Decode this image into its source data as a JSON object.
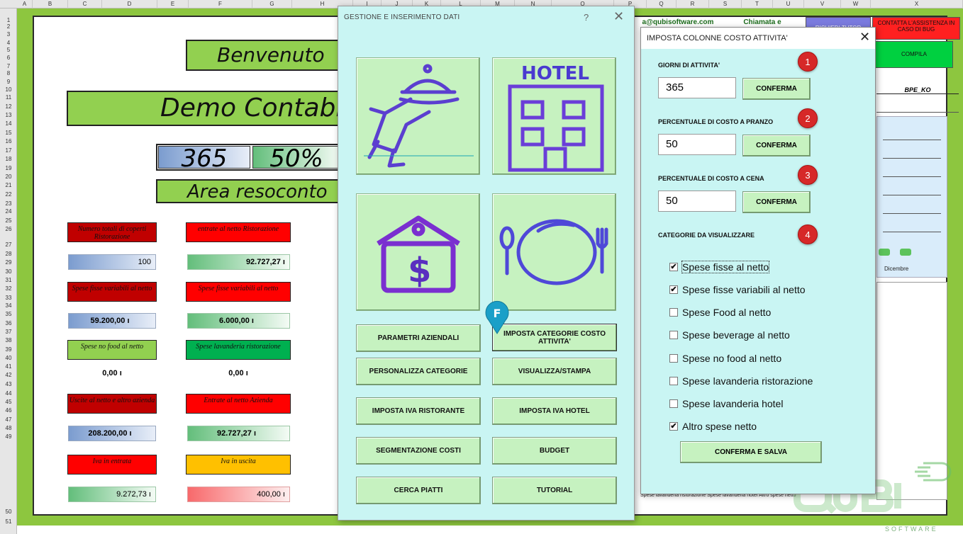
{
  "sheet": {
    "columns": [
      "A",
      "B",
      "C",
      "D",
      "E",
      "F",
      "G",
      "H",
      "I",
      "J",
      "K",
      "L",
      "M",
      "N",
      "O",
      "P",
      "Q",
      "R",
      "S",
      "T",
      "U",
      "V",
      "W",
      "X"
    ],
    "rows": [
      "1",
      "2",
      "3",
      "4",
      "5",
      "6",
      "7",
      "8",
      "9",
      "10",
      "11",
      "12",
      "13",
      "14",
      "15",
      "16",
      "17",
      "18",
      "19",
      "20",
      "21",
      "22",
      "23",
      "24",
      "25",
      "26",
      "27",
      "28",
      "29",
      "30",
      "31",
      "32",
      "33",
      "34",
      "35",
      "36",
      "37",
      "38",
      "39",
      "40",
      "41",
      "42",
      "43",
      "44",
      "45",
      "46",
      "47",
      "48",
      "49",
      "50",
      "51"
    ],
    "welcome": "Benvenuto",
    "demo_title": "Demo Contabi",
    "days_value": "365",
    "percent_value": "50%",
    "summary_title": "Area resoconto",
    "labels": {
      "covers": "Numero totali di coperti Ristorazione",
      "income_net_rest": "entrate al netto Ristorazione",
      "fixed_var_1": "Spese fisse variabili al netto",
      "fixed_var_2": "Spese fisse variabili al netto",
      "no_food": "Spese no food al netto",
      "laundry": "Spese lavanderia ristorazione",
      "out_net_company": "Uscite al netto e altro azienda",
      "in_net_company": "Entrate al netto Azienda",
      "vat_in": "Iva in entrata",
      "vat_out": "Iva in uscita"
    },
    "values": {
      "covers": "100",
      "income_net_rest": "92.727,27 ı",
      "fixed_var_1": "59.200,00 ı",
      "fixed_var_2": "6.000,00 ı",
      "no_food": "0,00 ı",
      "laundry": "0,00 ı",
      "out_net_company": "208.200,00 ı",
      "in_net_company": "92.727,27 ı",
      "vat_in": "9.272,73 ı",
      "vat_out": "400,00 ı"
    },
    "top_right": {
      "email": "a@qubisoftware.com",
      "call": "Chiamata e",
      "tutor": "RICHIEDI TUTOR",
      "support": "CONTATTA L'ASSISTENZA IN CASO DI BUG",
      "compile": "COMPILA",
      "code": "BPE_KO",
      "month": "Dicembre"
    },
    "legend": "Spese lavanderia ristorazione   Spese lavanderia hotel   Altro spese netto"
  },
  "main_dialog": {
    "title": "GESTIONE E INSERIMENTO DATI",
    "help": "?",
    "close": "✕",
    "hotel_text": "HOTEL",
    "marker_letter": "F",
    "buttons": {
      "parametri": "PARAMETRI AZIENDALI",
      "imposta_categorie": "IMPOSTA CATEGORIE COSTO ATTIVITA'",
      "personalizza": "PERSONALIZZA CATEGORIE",
      "visualizza": "VISUALIZZA/STAMPA",
      "iva_ristorante": "IMPOSTA IVA RISTORANTE",
      "iva_hotel": "IMPOSTA IVA HOTEL",
      "segmentazione": "SEGMENTAZIONE COSTI",
      "budget": "BUDGET",
      "cerca_piatti": "CERCA PIATTI",
      "tutorial": "TUTORIAL"
    }
  },
  "settings_dialog": {
    "title": "IMPOSTA COLONNE COSTO ATTIVITA'",
    "close": "✕",
    "sections": {
      "days": {
        "number": "1",
        "label": "GIORNI DI ATTIVITA'",
        "value": "365",
        "button": "CONFERMA"
      },
      "lunch": {
        "number": "2",
        "label": "PERCENTUALE DI COSTO A PRANZO",
        "value": "50",
        "button": "CONFERMA"
      },
      "dinner": {
        "number": "3",
        "label": "PERCENTUALE DI COSTO A CENA",
        "value": "50",
        "button": "CONFERMA"
      },
      "categories": {
        "number": "4",
        "label": "CATEGORIE DA VISUALIZZARE"
      }
    },
    "checkboxes": [
      {
        "label": "Spese fisse al netto",
        "mark": "✔"
      },
      {
        "label": "Spese fisse variabili al netto",
        "mark": "✔"
      },
      {
        "label": "Spese Food al netto",
        "mark": ""
      },
      {
        "label": "Spese beverage al netto",
        "mark": ""
      },
      {
        "label": "Spese no food al netto",
        "mark": ""
      },
      {
        "label": "Spese lavanderia ristorazione",
        "mark": ""
      },
      {
        "label": "Spese lavanderia hotel",
        "mark": ""
      },
      {
        "label": "Altro spese netto",
        "mark": "✔"
      }
    ],
    "save_button": "CONFERMA E SALVA"
  },
  "logo": {
    "text": "QUBI",
    "subtext": "SOFTWARE"
  }
}
